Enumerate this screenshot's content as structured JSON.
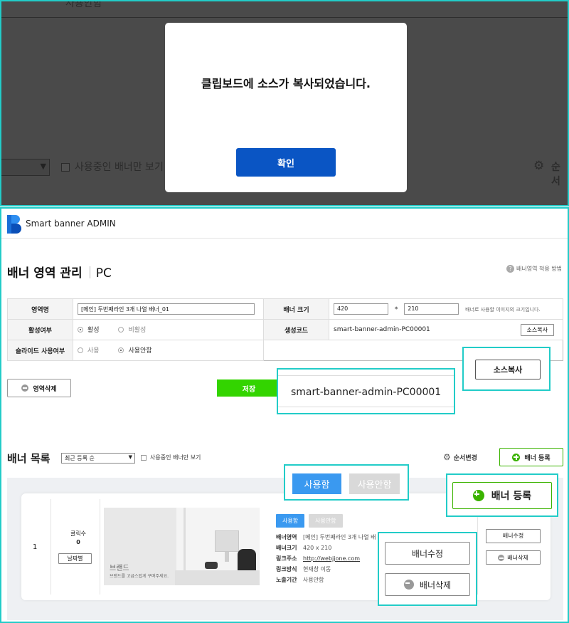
{
  "modal": {
    "message": "클립보드에 소스가 복사되었습니다.",
    "confirm_label": "확인"
  },
  "background": {
    "top_ghost_text": "사용안함",
    "used_only_label": "사용중인 배너만 보기",
    "order_label": "순서"
  },
  "header": {
    "brand": "Smart banner ADMIN"
  },
  "page": {
    "title": "배너 영역 관리",
    "platform": "PC",
    "help_link": "배너영역 적용 방법"
  },
  "form": {
    "area_name_label": "영역명",
    "area_name_value": "[메인] 두번째라인 3개 나열 배너_01",
    "banner_size_label": "배너 크기",
    "width": "420",
    "size_sep": "*",
    "height": "210",
    "size_note": "배너로 사용할 이미지의 크기입니다.",
    "active_label": "활성여부",
    "active_on": "활성",
    "active_off": "비활성",
    "gen_code_label": "생성코드",
    "gen_code_value": "smart-banner-admin-PC00001",
    "copy_source_label": "소스복사",
    "slide_label": "슬라이드 사용여부",
    "slide_use": "사용",
    "slide_nouse": "사용안함"
  },
  "actions": {
    "delete_area_label": "영역삭제",
    "save_label": "저장"
  },
  "zoom": {
    "copy_source_label": "소스복사",
    "code_value": "smart-banner-admin-PC00001",
    "use_label": "사용함",
    "nouse_label": "사용안함",
    "add_banner_label": "배너 등록",
    "edit_label": "배너수정",
    "delete_label": "배너삭제"
  },
  "list": {
    "title": "배너 목록",
    "sort_value": "최근 등록 순",
    "used_only_label": "사용중인 배너만 보기",
    "reorder_label": "순서변경",
    "add_banner_label": "배너 등록"
  },
  "banner": {
    "index": "1",
    "clicks_label": "클릭수",
    "clicks_value": "0",
    "date_button": "날짜별",
    "image_brand": "브랜드",
    "image_sub": "브랜드를 고급스럽게 꾸며주세요.",
    "use_label": "사용함",
    "nouse_label": "사용안함",
    "area_key": "배너영역",
    "area_value": "[메인] 두번째라인 3개 나열 배",
    "size_key": "배너크기",
    "size_value": "420 x 210",
    "link_key": "링크주소",
    "link_value": "http://webjjone.com",
    "method_key": "링크방식",
    "method_value": "현재창 이동",
    "period_key": "노출기간",
    "period_value": "사용안함",
    "edit_label": "배너수정",
    "delete_label": "배너삭제"
  },
  "colors": {
    "accent_blue": "#0a55c4",
    "save_green": "#33d400",
    "highlight_cyan": "#22ccc8",
    "use_blue": "#3a99f0"
  }
}
